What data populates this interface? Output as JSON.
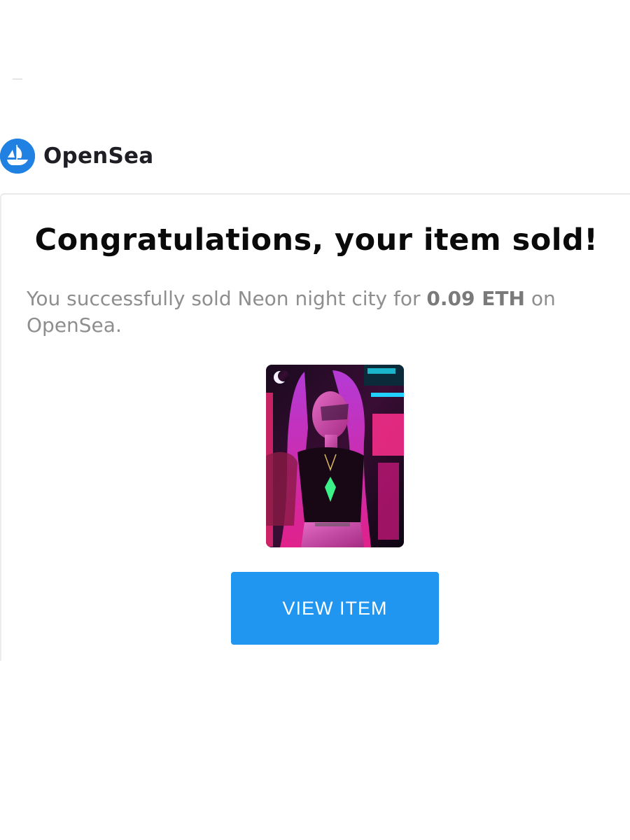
{
  "brand": {
    "name": "OpenSea",
    "icon": "opensea-logo-icon",
    "color": "#2081e2"
  },
  "email": {
    "headline": "Congratulations, your item sold!",
    "message": {
      "prefix": "You successfully sold Neon night city for",
      "amount": "0.09 ETH",
      "suffix": "on OpenSea."
    },
    "item_image": "neon-night-city-nft-image",
    "button": {
      "label": "VIEW ITEM",
      "color": "#2196f0"
    }
  }
}
